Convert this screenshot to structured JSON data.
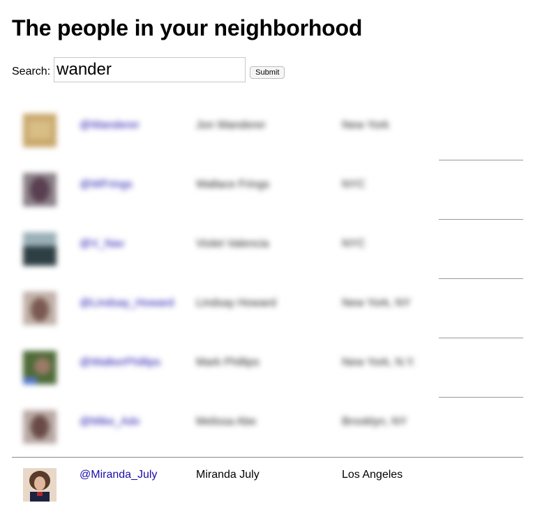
{
  "page_title": "The people in your neighborhood",
  "search": {
    "label": "Search:",
    "value": "wander",
    "submit_label": "Submit"
  },
  "results": [
    {
      "handle": "@Wanderer",
      "name": "Jon Wanderer",
      "location": "New York",
      "avatar_color": "#c9a86c",
      "blurred": true
    },
    {
      "handle": "@WFrings",
      "name": "Wallace Frings",
      "location": "NYC",
      "avatar_color": "#6f5a66",
      "blurred": true
    },
    {
      "handle": "@V_Nav",
      "name": "Violet Valencia",
      "location": "NYC",
      "avatar_color": "#3d4f55",
      "blurred": true
    },
    {
      "handle": "@Lindsay_Howard",
      "name": "Lindsay Howard",
      "location": "New York, NY",
      "avatar_color": "#8a6a60",
      "blurred": true
    },
    {
      "handle": "@WalkerPhillips",
      "name": "Mark Phillips",
      "location": "New York, N.Y.",
      "avatar_color": "#5f7a45",
      "blurred": true
    },
    {
      "handle": "@Mike_Adv",
      "name": "Melissa Abe",
      "location": "Brooklyn, NY",
      "avatar_color": "#7a5a55",
      "blurred": true
    },
    {
      "handle": "@Miranda_July",
      "name": "Miranda July",
      "location": "Los Angeles",
      "avatar_color": "#d9b5a0",
      "blurred": false
    }
  ]
}
